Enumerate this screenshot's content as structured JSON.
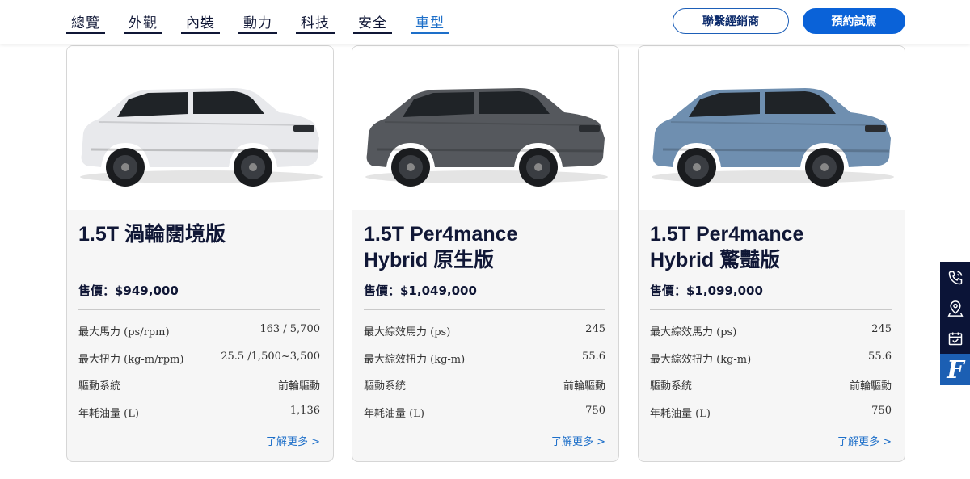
{
  "nav": {
    "items": [
      {
        "label": "總覽"
      },
      {
        "label": "外觀"
      },
      {
        "label": "內裝"
      },
      {
        "label": "動力"
      },
      {
        "label": "科技"
      },
      {
        "label": "安全"
      },
      {
        "label": "車型"
      }
    ],
    "active_index": 6
  },
  "buttons": {
    "dealer": "聯繫經銷商",
    "test_drive": "預約試駕"
  },
  "colors": {
    "accent": "#0a62d8",
    "nav_active": "#1d6fc9",
    "text_dark": "#101736",
    "sidebar_bg": "#0b1437"
  },
  "cards": [
    {
      "title_line1": "1.5T 渦輪闊境版",
      "title_line2": "",
      "price": "售價：$949,000",
      "car_color": "#e8e9ec",
      "specs": [
        {
          "k": "最大馬力 (ps/rpm)",
          "v": "163 / 5,700"
        },
        {
          "k": "最大扭力 (kg-m/rpm)",
          "v": "25.5 /1,500~3,500"
        },
        {
          "k": "驅動系統",
          "v": "前輪驅動"
        },
        {
          "k": "年耗油量 (L)",
          "v": "1,136"
        }
      ],
      "more": "了解更多 >"
    },
    {
      "title_line1": "1.5T Per4mance",
      "title_line2": "Hybrid 原生版",
      "price": "售價：$1,049,000",
      "car_color": "#55585d",
      "specs": [
        {
          "k": "最大綜效馬力 (ps)",
          "v": "245"
        },
        {
          "k": "最大綜效扭力 (kg-m)",
          "v": "55.6"
        },
        {
          "k": "驅動系統",
          "v": "前輪驅動"
        },
        {
          "k": "年耗油量 (L)",
          "v": "750"
        }
      ],
      "more": "了解更多 >"
    },
    {
      "title_line1": "1.5T Per4mance",
      "title_line2": "Hybrid 驚豔版",
      "price": "售價：$1,099,000",
      "car_color": "#6f8fb0",
      "specs": [
        {
          "k": "最大綜效馬力 (ps)",
          "v": "245"
        },
        {
          "k": "最大綜效扭力 (kg-m)",
          "v": "55.6"
        },
        {
          "k": "驅動系統",
          "v": "前輪驅動"
        },
        {
          "k": "年耗油量 (L)",
          "v": "750"
        }
      ],
      "more": "了解更多 >"
    }
  ],
  "sidebar": {
    "icons": [
      "phone-icon",
      "location-pin-icon",
      "calendar-icon",
      "ford-logo-icon"
    ]
  }
}
